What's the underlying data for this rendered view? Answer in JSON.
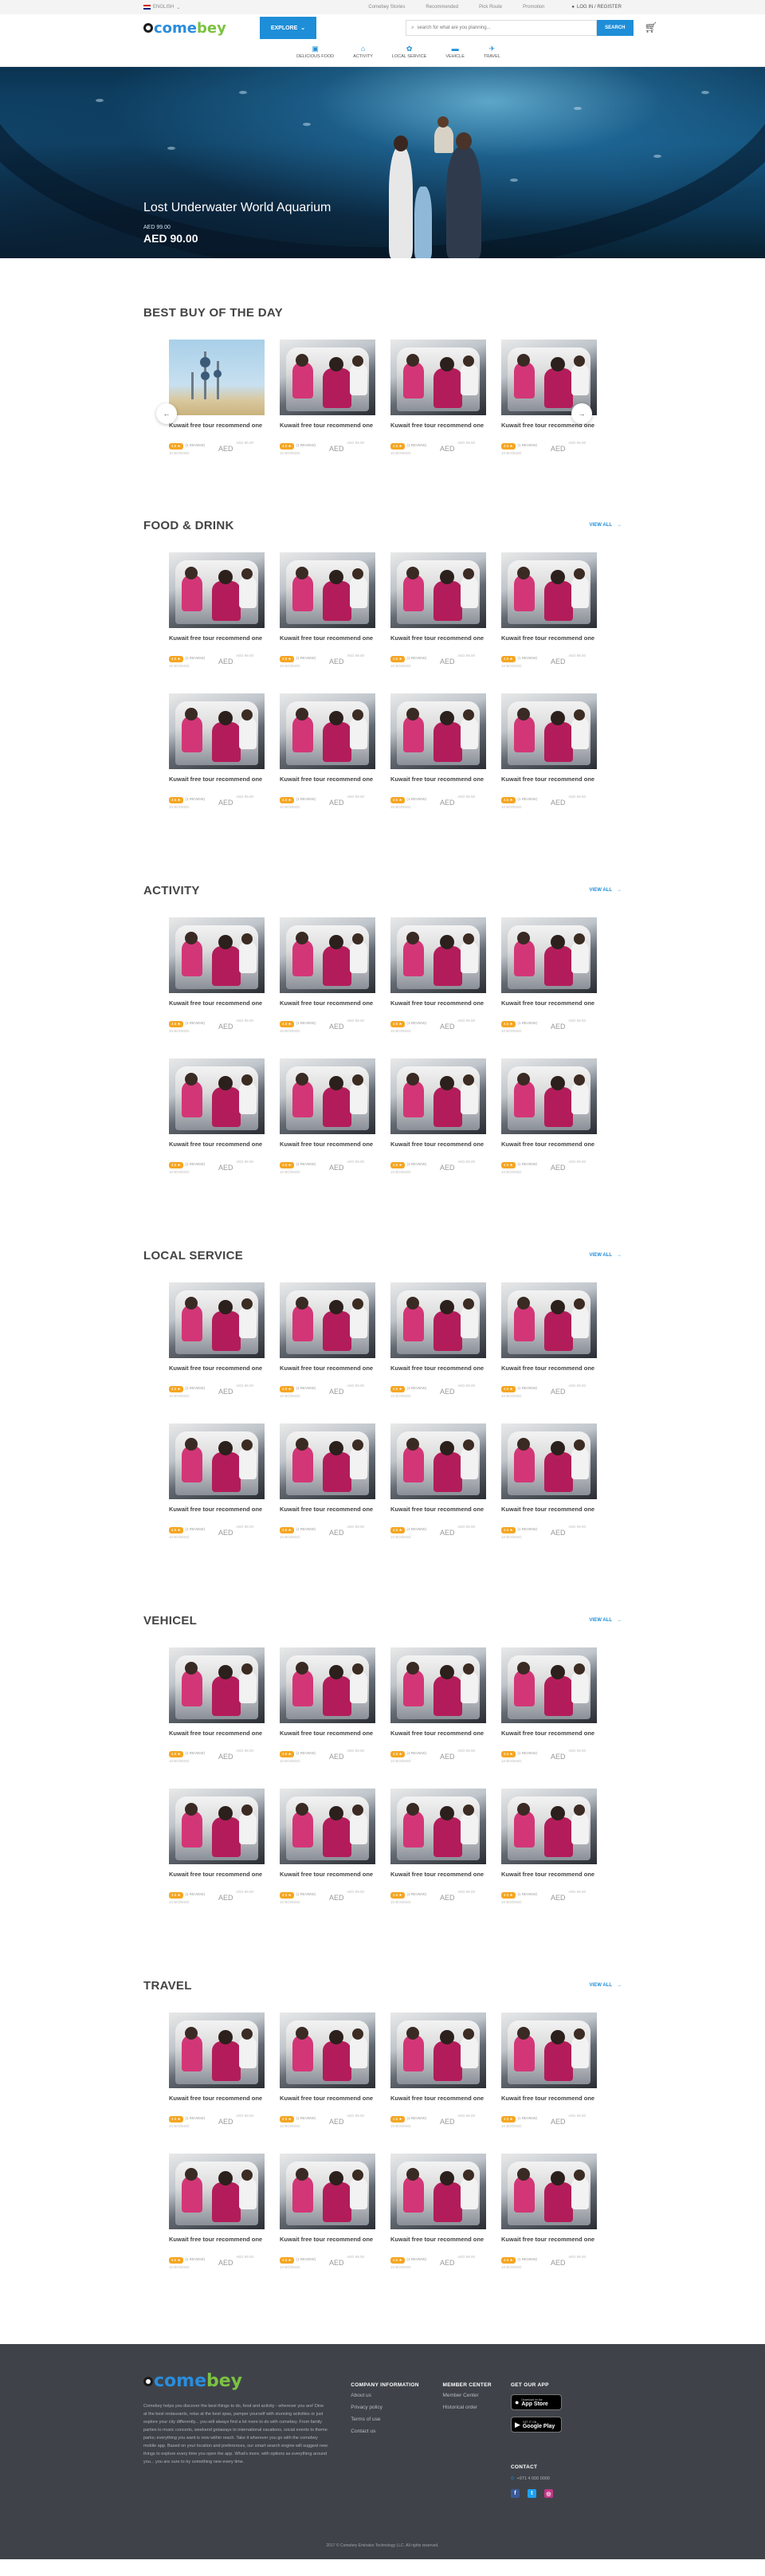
{
  "topbar": {
    "language": "ENGLISH",
    "links": [
      "Comebey Stories",
      "Recommended",
      "Pick Route",
      "Promotion"
    ],
    "login": "LOG IN / REGISTER"
  },
  "header": {
    "logo_part1": "come",
    "logo_part2": "bey",
    "explore": "EXPLORE",
    "search_placeholder": "search for what are you planning...",
    "search_button": "SEARCH"
  },
  "nav": [
    {
      "label": "DELICIOUS FOOD",
      "icon": "food-icon",
      "glyph": "▣"
    },
    {
      "label": "ACTIVITY",
      "icon": "activity-icon",
      "glyph": "⌂"
    },
    {
      "label": "LOCAL SERVICE",
      "icon": "local-service-icon",
      "glyph": "✿"
    },
    {
      "label": "VEHICLE",
      "icon": "vehicle-icon",
      "glyph": "▬"
    },
    {
      "label": "TRAVEL",
      "icon": "plane-icon",
      "glyph": "✈"
    }
  ],
  "hero": {
    "title": "Lost Underwater World Aquarium",
    "from": "AED 99.00",
    "price": "AED 90.00"
  },
  "card": {
    "name": "Kuwait free tour recommend one",
    "rating": "4.5 ★",
    "reviews": "(1 REVIEW)",
    "booked": "10 BOOKED",
    "was": "AED 99.00",
    "currency": "AED"
  },
  "sections": {
    "bestbuy": {
      "title": "BEST BUY OF THE DAY"
    },
    "food": {
      "title": "FOOD & DRINK",
      "view_all": "VIEW ALL"
    },
    "activity": {
      "title": "ACTIVITY",
      "view_all": "VIEW ALL"
    },
    "local": {
      "title": "LOCAL SERVICE",
      "view_all": "VIEW ALL"
    },
    "vehicle": {
      "title": "VEHICEL",
      "view_all": "VIEW ALL"
    },
    "travel": {
      "title": "TRAVEL",
      "view_all": "VIEW ALL"
    }
  },
  "footer": {
    "description": "Comebey helps you discover the best things to do, food and activity - wherever you are! Dine at the best restaurants, relax at the best spas, pamper yourself with stunning activities or just explore your city differently... you will always find a lot more to do with comebey. From family parties to music concerts, weekend getaways to international vacations, social events to theme parks; everything you want is now within reach. Take it wherever you go with the comebey mobile app. Based on your location and preferences, our smart search engine will suggest new things to explore every time you open the app. What's more, with options as everything around you... you are sure to try something new every time.",
    "company_heading": "COMPANY INFORMATION",
    "company_links": [
      "About us",
      "Privacy policy",
      "Terms of use",
      "Contact us"
    ],
    "member_heading": "MEMBER CENTER",
    "member_links": [
      "Member Center",
      "Historical order"
    ],
    "app_heading": "GET OUR APP",
    "app_store_small": "Download on the",
    "app_store": "App Store",
    "google_small": "GET IT ON",
    "google": "Google Play",
    "contact_heading": "CONTACT",
    "contact_line": "+971 4 000 0000",
    "copyright": "2017 © Comebey Emirates Technology LLC. All rights reserved."
  },
  "colors": {
    "accent": "#1e8ed8",
    "footer": "#3f4349",
    "badge": "#f5a623"
  }
}
